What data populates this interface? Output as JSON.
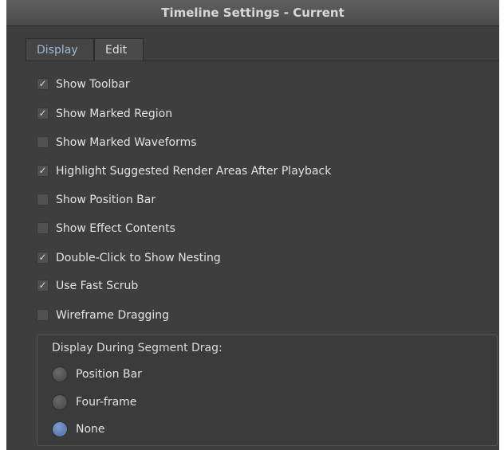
{
  "window": {
    "title": "Timeline Settings - Current"
  },
  "tabs": [
    {
      "label": "Display",
      "active": true
    },
    {
      "label": "Edit",
      "active": false
    }
  ],
  "options": [
    {
      "label": "Show Toolbar",
      "checked": true
    },
    {
      "label": "Show Marked Region",
      "checked": true
    },
    {
      "label": "Show Marked Waveforms",
      "checked": false
    },
    {
      "label": "Highlight Suggested Render Areas After Playback",
      "checked": true
    },
    {
      "label": "Show Position Bar",
      "checked": false
    },
    {
      "label": "Show Effect Contents",
      "checked": false
    },
    {
      "label": "Double-Click to Show Nesting",
      "checked": true
    },
    {
      "label": "Use Fast Scrub",
      "checked": true
    },
    {
      "label": "Wireframe Dragging",
      "checked": false
    }
  ],
  "segment_drag": {
    "title": "Display During Segment Drag:",
    "options": [
      {
        "label": "Position Bar",
        "selected": false
      },
      {
        "label": "Four-frame",
        "selected": false
      },
      {
        "label": "None",
        "selected": true
      }
    ]
  },
  "colors": {
    "panel_background": "#3e3e3e",
    "active_tab_text": "#9fb8d8",
    "check_mark": "#c6d7ee",
    "selected_radio": "#4b6a9c"
  }
}
